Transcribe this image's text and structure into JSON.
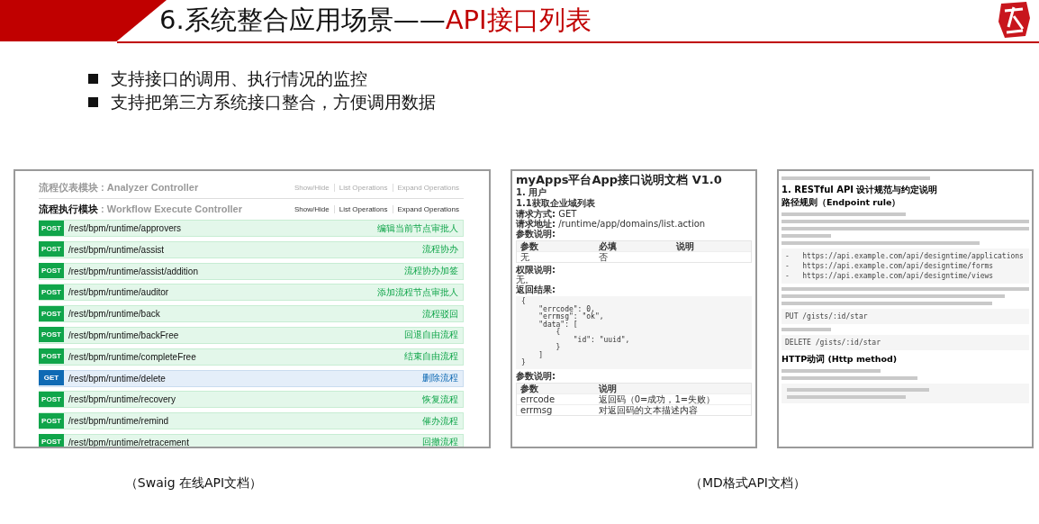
{
  "slide": {
    "number_title": "6.系统整合应用场景——",
    "title_highlight": "API接口列表"
  },
  "bullets": [
    "支持接口的调用、执行情况的监控",
    "支持把第三方系统接口整合，方便调用数据"
  ],
  "swagger": {
    "modules": [
      {
        "name": "流程仪表模块",
        "controller": " : Analyzer Controller",
        "expanded": false,
        "links": [
          "Show/Hide",
          "List Operations",
          "Expand Operations"
        ]
      },
      {
        "name": "流程执行模块",
        "controller": " : Workflow Execute Controller",
        "expanded": true,
        "links": [
          "Show/Hide",
          "List Operations",
          "Expand Operations"
        ]
      }
    ],
    "endpoints": [
      {
        "kind": "post",
        "method": "POST",
        "path": "/rest/bpm/runtime/approvers",
        "summary": "编辑当前节点审批人"
      },
      {
        "kind": "post",
        "method": "POST",
        "path": "/rest/bpm/runtime/assist",
        "summary": "流程协办"
      },
      {
        "kind": "post",
        "method": "POST",
        "path": "/rest/bpm/runtime/assist/addition",
        "summary": "流程协办加签"
      },
      {
        "kind": "post",
        "method": "POST",
        "path": "/rest/bpm/runtime/auditor",
        "summary": "添加流程节点审批人"
      },
      {
        "kind": "post",
        "method": "POST",
        "path": "/rest/bpm/runtime/back",
        "summary": "流程驳回"
      },
      {
        "kind": "post",
        "method": "POST",
        "path": "/rest/bpm/runtime/backFree",
        "summary": "回退自由流程"
      },
      {
        "kind": "post",
        "method": "POST",
        "path": "/rest/bpm/runtime/completeFree",
        "summary": "结束自由流程"
      },
      {
        "kind": "get",
        "method": "GET",
        "path": "/rest/bpm/runtime/delete",
        "summary": "删除流程"
      },
      {
        "kind": "post",
        "method": "POST",
        "path": "/rest/bpm/runtime/recovery",
        "summary": "恢复流程"
      },
      {
        "kind": "post",
        "method": "POST",
        "path": "/rest/bpm/runtime/remind",
        "summary": "催办流程"
      },
      {
        "kind": "post",
        "method": "POST",
        "path": "/rest/bpm/runtime/retracement",
        "summary": "回撤流程"
      }
    ]
  },
  "app_doc": {
    "title": "myApps平台App接口说明文档 V1.0",
    "section": "1. 用户",
    "subsection": "1.1获取企业域列表",
    "request": [
      {
        "label": "请求方式:",
        "value": "GET"
      },
      {
        "label": "请求地址:",
        "value": "/runtime/app/domains/list.action"
      }
    ],
    "params_label": "参数说明:",
    "params_columns": [
      "参数",
      "必填",
      "说明"
    ],
    "params_row": [
      "无",
      "否"
    ],
    "auth_label": "权限说明:",
    "auth_value": "无。",
    "result_label": "返回结果:",
    "code": [
      "{",
      "    \"errcode\": 0,",
      "    \"errmsg\": \"ok\",",
      "    \"data\": [",
      "        {",
      "            \"id\": \"uuid\",",
      "        }",
      "    ]",
      "}"
    ],
    "result_params_label": "参数说明:",
    "result_columns": [
      "参数",
      "说明"
    ],
    "result_rows": [
      [
        "errcode",
        "返回码（0=成功，1=失败）"
      ],
      [
        "errmsg",
        "对返回码的文本描述内容"
      ]
    ]
  },
  "md_doc": {
    "title": "1. RESTful API 设计规范与约定说明",
    "heading": "路径规则（Endpoint rule）",
    "urls": [
      "-   https://api.example.com/api/designtime/applications",
      "-   https://api.example.com/api/designtime/forms",
      "-   https://api.example.com/api/designtime/views"
    ],
    "put_code": "PUT /gists/:id/star",
    "delete_code": "DELETE /gists/:id/star",
    "heading2": "HTTP动词 (Http method)"
  },
  "captions": [
    "（Swaig 在线API文档）",
    "（MD格式API文档）"
  ]
}
